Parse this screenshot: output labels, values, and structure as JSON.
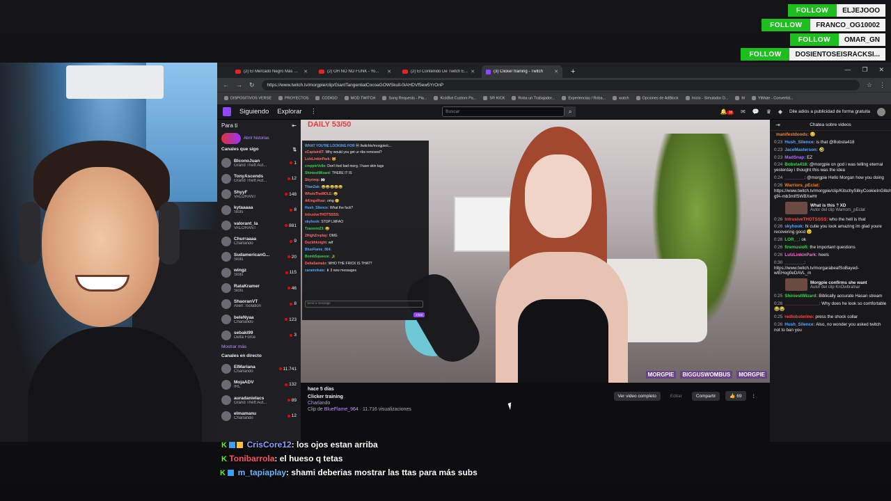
{
  "alerts": [
    {
      "label": "FOLLOW",
      "name": "ELJEJOOO"
    },
    {
      "label": "FOLLOW",
      "name": "FRANCO_OG10002"
    },
    {
      "label": "FOLLOW",
      "name": "OMAR_GN"
    },
    {
      "label": "FOLLOW",
      "name": "DOSIENTOSEISRACKSI..."
    }
  ],
  "browser": {
    "tabs": [
      {
        "label": "(2) El Mercado Negro Más Gr...",
        "kind": "yt"
      },
      {
        "label": "(2) OH NO NO FUNK - Yo...",
        "kind": "yt"
      },
      {
        "label": "(2) El Contenido De Twitch E...",
        "kind": "yt"
      },
      {
        "label": "(3) Clicker training - Twitch",
        "kind": "tw",
        "active": true
      }
    ],
    "url": "https://www.twitch.tv/morgpie/clip/GiantTangentialCocoaGOWSkull-0iAHDVf5ew5YrOnP",
    "bookmarks": [
      "DISPOSITIVOS VERSE",
      "PROYECTOS",
      "CODIGO",
      "MOD TWITCH",
      "Song Requests - Pla...",
      "KickBot Custom Pa...",
      "SR KICK",
      "Roba un Trabajador...",
      "Experiencias / Roba...",
      "watch",
      "Opciones de AdBlock",
      "Inicio - Simulador D...",
      "M",
      "YtMate - Convertid..."
    ]
  },
  "twitch": {
    "nav": {
      "following": "Siguiendo",
      "browse": "Explorar",
      "more": "⋮",
      "search_placeholder": "Buscar",
      "notif_count": "18",
      "promo": "Dile adiós a publicidad de forma gratuita"
    },
    "sidebar": {
      "title": "Para ti",
      "stories": "Abrir historias",
      "followed_header": "Canales que sigo",
      "followed": [
        {
          "name": "BlconoJuan",
          "game": "Grand Theft Aut...",
          "viewers": "1"
        },
        {
          "name": "TonyAscends",
          "game": "Grand Theft Aut...",
          "viewers": "12"
        },
        {
          "name": "ShyyF",
          "game": "VALORANT",
          "viewers": "148"
        },
        {
          "name": "kytaaaaa",
          "game": "Slots",
          "viewers": "8"
        },
        {
          "name": "valorant_la",
          "game": "VALORANT",
          "viewers": "881"
        },
        {
          "name": "Churraaaa",
          "game": "Charlando",
          "viewers": "9"
        },
        {
          "name": "SudamericanG...",
          "game": "Slots",
          "viewers": "20"
        },
        {
          "name": "wingz",
          "game": "Slots",
          "viewers": "115"
        },
        {
          "name": "RataKramer",
          "game": "Slots",
          "viewers": "46"
        },
        {
          "name": "ShaoranVT",
          "game": "Alien: Isolation",
          "viewers": "8"
        },
        {
          "name": "beleNyaa",
          "game": "Charlando",
          "viewers": "123"
        },
        {
          "name": "sebaki99",
          "game": "Delta Force",
          "viewers": "3"
        }
      ],
      "show_more": "Mostrar más",
      "live_header": "Canales en directo",
      "live": [
        {
          "name": "ElMariana",
          "game": "Charlando",
          "viewers": "11.741"
        },
        {
          "name": "MojaADV",
          "game": "IRL",
          "viewers": "132"
        },
        {
          "name": "auradanielacs",
          "game": "Grand Theft Aut...",
          "viewers": "89"
        },
        {
          "name": "elmamanu",
          "game": "Charlando",
          "viewers": "12"
        }
      ]
    },
    "player": {
      "overlay_title": "DAILY 53/50",
      "watermarks": [
        "MORGPIE",
        "BIGGUSWOMBUS",
        "MORGPIE"
      ],
      "chat_lines": [
        {
          "user": "WHAT YOU'RE LOOKING FOR",
          "msg": "Ⓜ /twitchtv/morgpie/c...",
          "c": "b"
        },
        {
          "user": "xCaptain8T:",
          "msg": "Why would you get ur ribs removed?",
          "c": "r"
        },
        {
          "user": "LulzLinkinPark:",
          "msg": "🐱",
          "c": "r"
        },
        {
          "user": "creppieVelle:",
          "msg": "Don't feel bad morg. I have skin tags",
          "c": "g"
        },
        {
          "user": "ShiniestWizard:",
          "msg": "THERE IT IS",
          "c": "g"
        },
        {
          "user": "Skyrimp:",
          "msg": "👀",
          "c": "r"
        },
        {
          "user": "TitanZak:",
          "msg": "😂😂😂😂😂",
          "c": "b"
        },
        {
          "user": "WhoIsTheMOLE:",
          "msg": "😂",
          "c": "r"
        },
        {
          "user": "AKingsRoar:",
          "msg": "omg 🙂",
          "c": "r"
        },
        {
          "user": "Hush_Silence:",
          "msg": "What the fuck?",
          "c": "b"
        },
        {
          "user": "IntrusiveTHOTSSSS:",
          "msg": "",
          "c": "r"
        },
        {
          "user": "skyhook:",
          "msg": "STOP LMFAO",
          "c": "b"
        },
        {
          "user": "Tzaoonn23:",
          "msg": "😂",
          "c": "g"
        },
        {
          "user": "2HighZreplay:",
          "msg": "OMG",
          "c": "r"
        },
        {
          "user": "Duckfrknight:",
          "msg": "wtf",
          "c": "r"
        },
        {
          "user": "BlueFlame_964:",
          "msg": "",
          "c": "b"
        },
        {
          "user": "BombSqueeze:",
          "msg": "🐊",
          "c": "g"
        },
        {
          "user": "DeltaSainabr:",
          "msg": "WHO THE FRICK IS THAT?",
          "c": "r"
        },
        {
          "user": "caramokate:",
          "msg": "⬇ 3 new messages",
          "c": "b"
        }
      ],
      "chat_input": "Send a message",
      "chat_send": "Chat"
    },
    "clip": {
      "when": "hace 5 días",
      "title": "Clicker training",
      "category": "Charlando",
      "clipped_by_prefix": "Clip de",
      "clipper": "BlueFlame_964",
      "views": "· 11.716 visualizaciones",
      "watch_full": "Ver video completo",
      "edit": "Editar",
      "share": "Compartir",
      "likes": "69"
    },
    "chat": {
      "header": "Chatea sobre videos",
      "messages": [
        {
          "t": "",
          "u": "manifestdoods:",
          "uc": "c-orange",
          "m": "😊"
        },
        {
          "t": "0:23",
          "u": "Hush_Silence:",
          "uc": "c-blue",
          "m": "is that @Bobsta418"
        },
        {
          "t": "0:23",
          "u": "JaceMasterson:",
          "uc": "c-blue",
          "m": "🤣"
        },
        {
          "t": "0:23",
          "u": "MadSnap:",
          "uc": "c-purple",
          "m": "EZ"
        },
        {
          "t": "0:24",
          "u": "Bobsta418:",
          "uc": "c-green",
          "m": "@morgpie on god i was telling eternal yesterday i thought this was the idea"
        },
        {
          "t": "0:24",
          "u": "________:",
          "uc": "c-purple",
          "m": "@morgpie Hello Morgan how you doing"
        },
        {
          "t": "0:26",
          "u": "Warriors_pEclat:",
          "uc": "c-orange",
          "m": "https://www.twitch.tv/morgpie/clip/KitschySilkyCookieInGlitch-gfA-mb3mlfSWBXwHr"
        }
      ],
      "embed1": {
        "title": "What is this ? XD",
        "sub": "Autor del clip Warriors_pEclat"
      },
      "messages2": [
        {
          "t": "0:26",
          "u": "IntrusiveTHOTSSSS:",
          "uc": "c-red",
          "m": "who the hell is that"
        },
        {
          "t": "0:26",
          "u": "skyhook:",
          "uc": "c-blue",
          "m": "hi cutie you look amazing im glad youre recovering good 😉"
        },
        {
          "t": "0:26",
          "u": "LOR__:",
          "uc": "c-green",
          "m": "ok"
        },
        {
          "t": "0:26",
          "u": "firemusiofi:",
          "uc": "c-green",
          "m": "the important questions"
        },
        {
          "t": "0:26",
          "u": "LulzLinkinPark:",
          "uc": "c-pink",
          "m": "heels"
        },
        {
          "t": "0:30",
          "u": "________:",
          "uc": "c-blue",
          "m": "https://www.twitch.tv/morgarabeafSoBayed-wlEHog0eDAVL_m"
        }
      ],
      "embed2": {
        "title": "Morgpie confirms she want",
        "sub": "Autor del clip KnOwbralnar"
      },
      "messages3": [
        {
          "t": "0:25",
          "u": "ShiniestWizard:",
          "uc": "c-green",
          "m": "Biblically accurate Hasan stream"
        },
        {
          "t": "0:26",
          "u": "______________:",
          "uc": "c-red",
          "m": "Why does he look so comfortable😂😂"
        },
        {
          "t": "0:25",
          "u": "redlobsterino:",
          "uc": "c-red",
          "m": "press the shock collar"
        },
        {
          "t": "0:26",
          "u": "Hush_Silence:",
          "uc": "c-blue",
          "m": "Also, no wonder you asked twitch not to ban you"
        }
      ]
    }
  },
  "overlay_chat": [
    {
      "user": "CrisCore12",
      "msg": ": los ojos estan arriba",
      "badges": "kick-blue-yellow"
    },
    {
      "user": "Tonibarrola",
      "msg": ": el hueso q tetas",
      "badges": "kick"
    },
    {
      "user": "m_tapiaplay",
      "msg": ": shami deberias mostrar las ttas para más subs",
      "badges": "kick-blue"
    }
  ]
}
